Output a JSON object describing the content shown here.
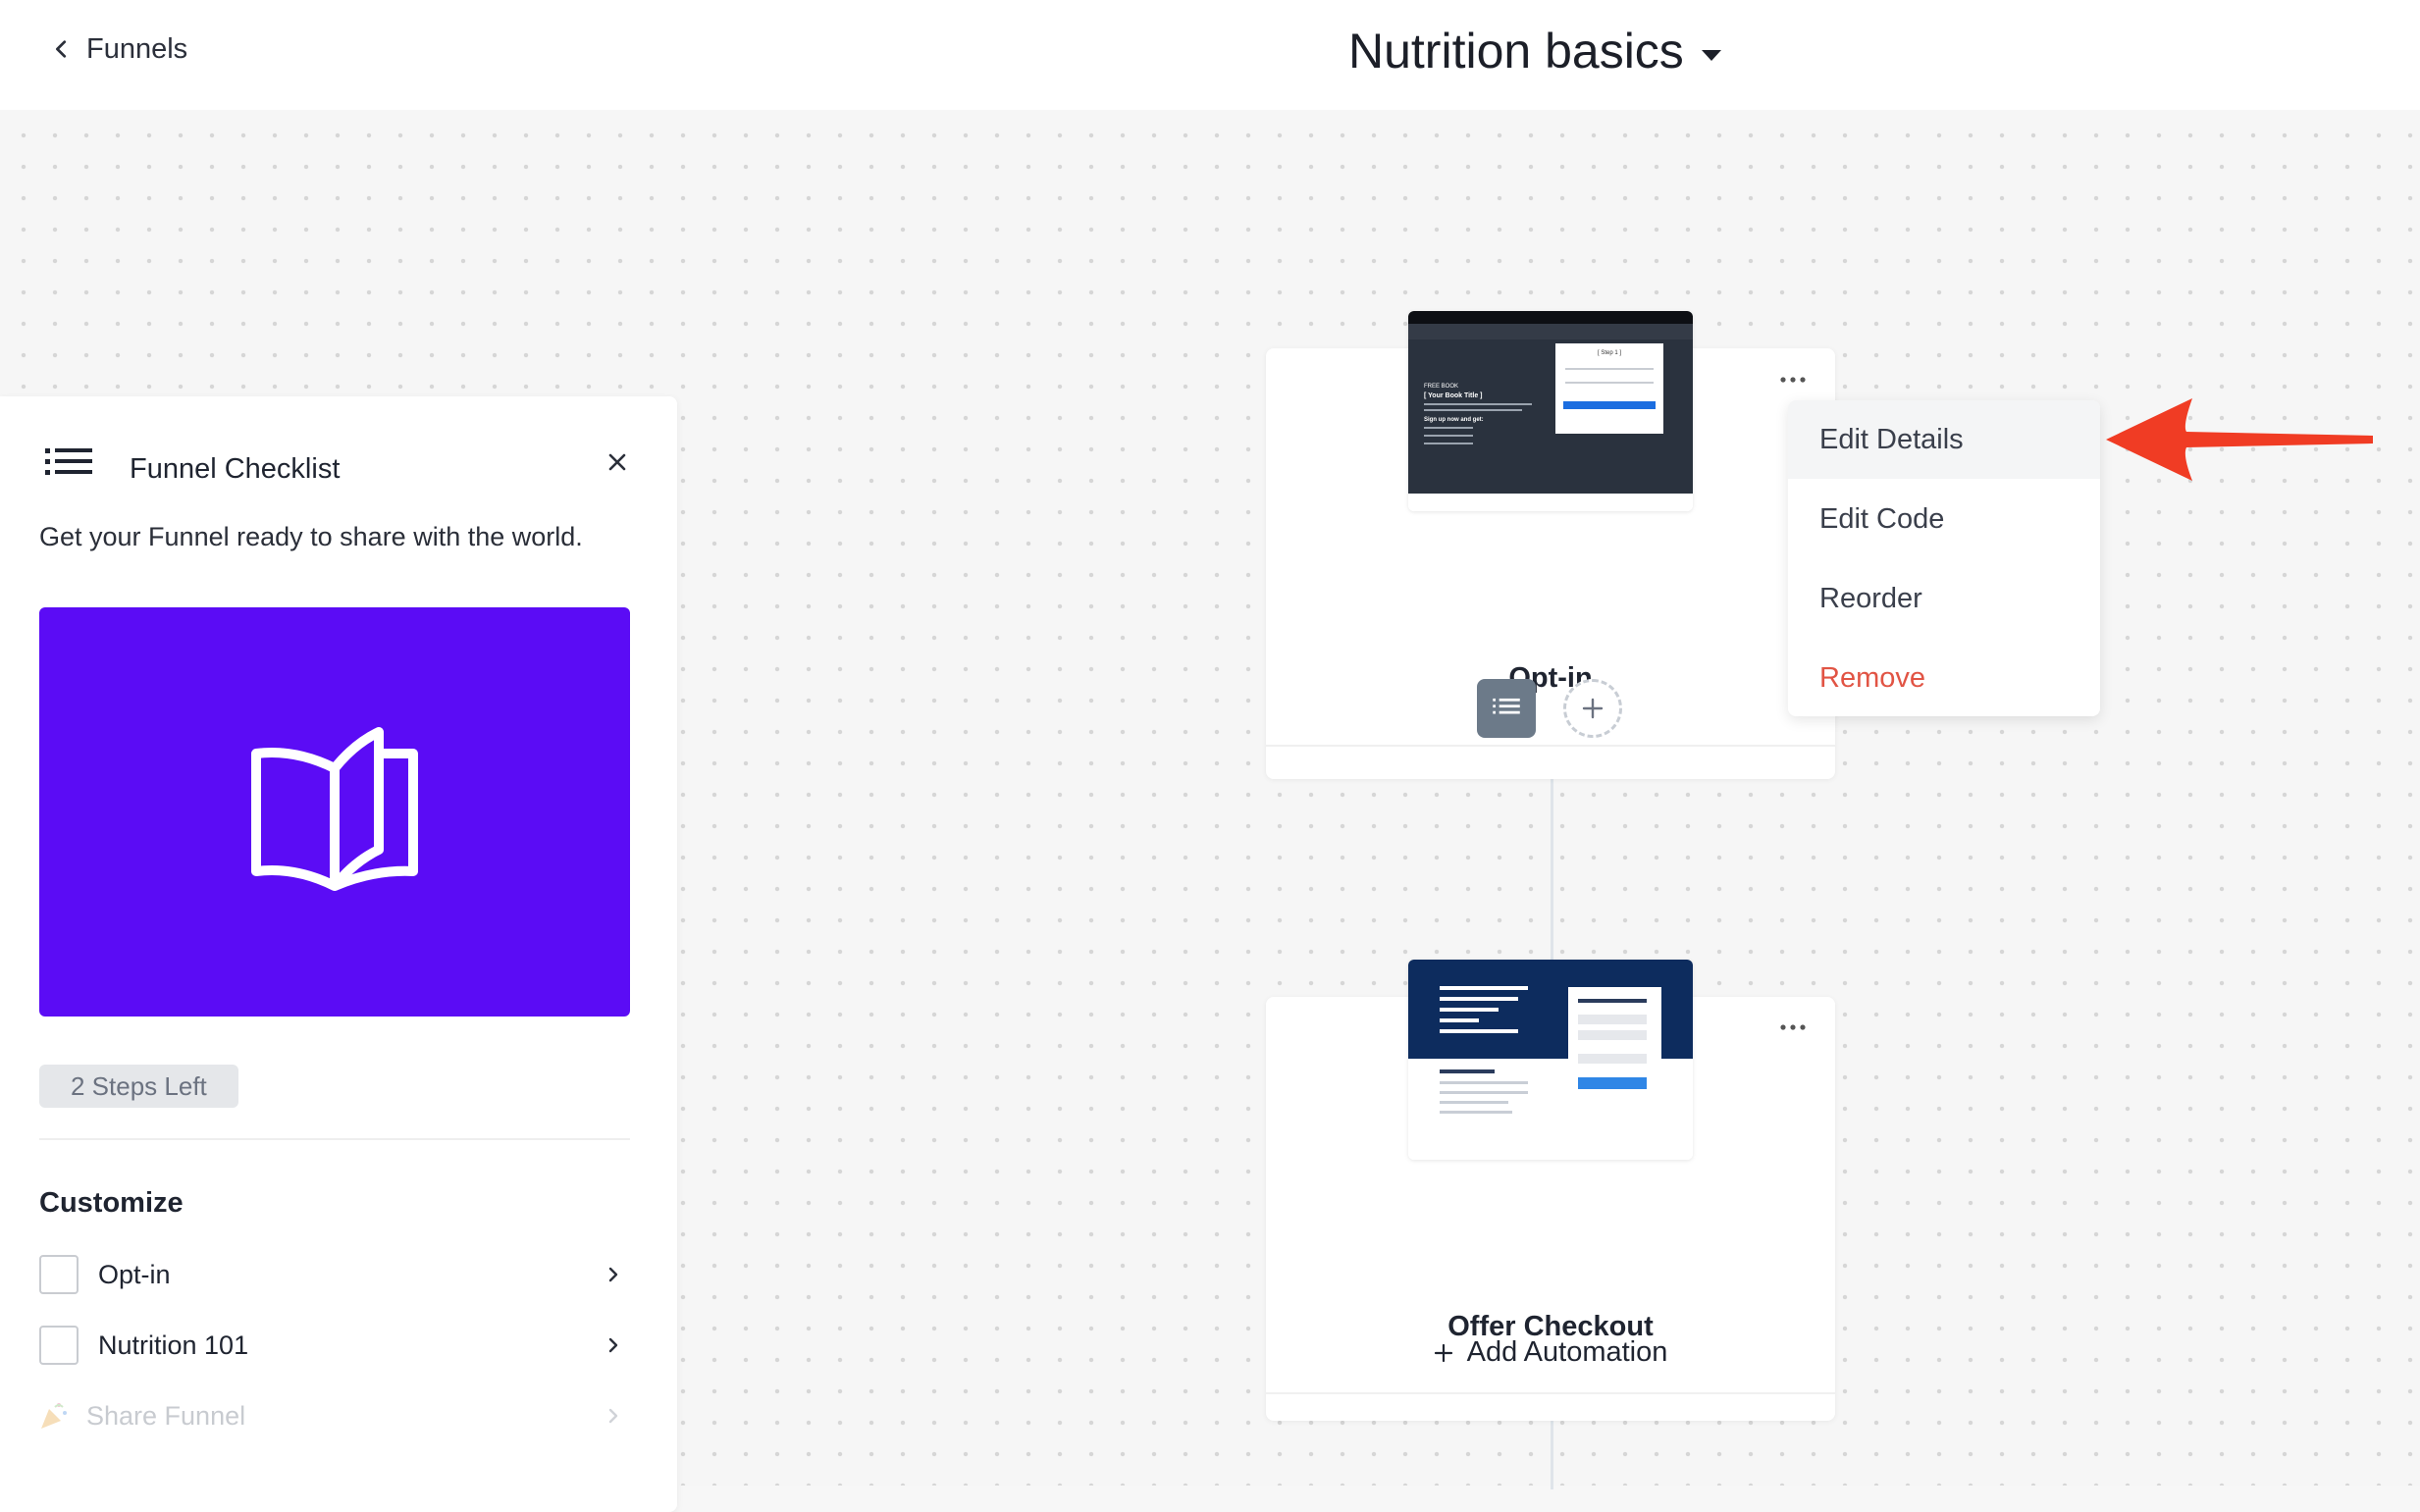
{
  "header": {
    "back_label": "Funnels",
    "title": "Nutrition basics"
  },
  "checklist": {
    "title": "Funnel Checklist",
    "subtitle": "Get your Funnel ready to share with the world.",
    "hero_color": "#5b0cf5",
    "steps_left": "2 Steps Left",
    "section_title": "Customize",
    "items": [
      {
        "label": "Opt-in",
        "checked": false
      },
      {
        "label": "Nutrition 101",
        "checked": false
      },
      {
        "label": "Share Funnel",
        "disabled": true
      }
    ]
  },
  "canvas": {
    "nodes": [
      {
        "name": "Opt-in",
        "thumbnail": {
          "top_text": "FREE BOOK",
          "headline": "[ Your Book Title ]",
          "cta": "Sign up now and get:",
          "form_title": "[ Step 1 ]"
        }
      },
      {
        "name": "Offer Checkout",
        "action": "Add Automation"
      }
    ]
  },
  "context_menu": {
    "items": [
      {
        "label": "Edit Details",
        "highlighted": true
      },
      {
        "label": "Edit Code"
      },
      {
        "label": "Reorder"
      },
      {
        "label": "Remove",
        "danger": true
      }
    ]
  },
  "colors": {
    "accent_purple": "#5b0cf5",
    "danger": "#e15444",
    "annotation_arrow": "#f03c24"
  }
}
